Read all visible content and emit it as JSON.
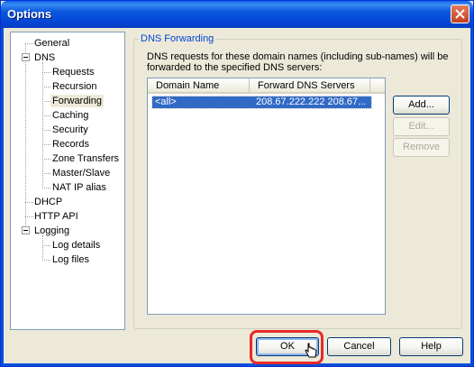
{
  "window": {
    "title": "Options"
  },
  "tree": {
    "items": [
      {
        "label": "General"
      },
      {
        "label": "DNS"
      },
      {
        "label": "Requests"
      },
      {
        "label": "Recursion"
      },
      {
        "label": "Forwarding"
      },
      {
        "label": "Caching"
      },
      {
        "label": "Security"
      },
      {
        "label": "Records"
      },
      {
        "label": "Zone Transfers"
      },
      {
        "label": "Master/Slave"
      },
      {
        "label": "NAT IP alias"
      },
      {
        "label": "DHCP"
      },
      {
        "label": "HTTP API"
      },
      {
        "label": "Logging"
      },
      {
        "label": "Log details"
      },
      {
        "label": "Log files"
      }
    ],
    "selected": "Forwarding"
  },
  "panel": {
    "group_label": "DNS Forwarding",
    "description": "DNS requests for these domain names (including sub-names) will be forwarded to the specified DNS servers:",
    "columns": [
      "Domain Name",
      "Forward DNS Servers"
    ],
    "rows": [
      {
        "domain": "<all>",
        "servers": "208.67.222.222 208.67..."
      }
    ],
    "add_label": "Add...",
    "edit_label": "Edit...",
    "remove_label": "Remove"
  },
  "footer": {
    "ok_label": "OK",
    "cancel_label": "Cancel",
    "help_label": "Help"
  },
  "colors": {
    "highlight": "#e52a2a",
    "selection": "#316ac5",
    "title_bar": "#0a58df"
  }
}
